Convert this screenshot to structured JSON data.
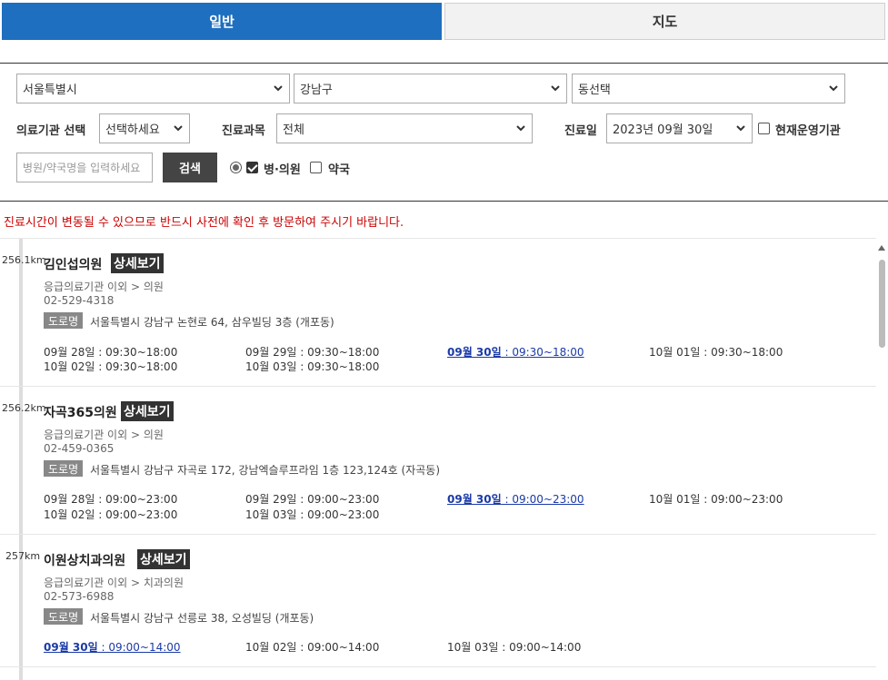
{
  "tabs": {
    "general": "일반",
    "map": "지도"
  },
  "filters": {
    "region1": "서울특별시",
    "region2": "강남구",
    "region3": "동선택",
    "institution_label": "의료기관 선택",
    "institution_value": "선택하세요",
    "dept_label": "진료과목",
    "dept_value": "전체",
    "date_label": "진료일",
    "date_value": "2023년 09월 30일",
    "open_now_label": "현재운영기관",
    "name_placeholder": "병원/약국명을 입력하세요",
    "search_label": "검색",
    "clinic_label": "병·의원",
    "pharmacy_label": "약국"
  },
  "notice": "진료시간이 변동될 수 있으므로 반드시 사전에 확인 후 방문하여 주시기 바랍니다.",
  "detail_label": "상세보기",
  "road_label": "도로명",
  "clinics": [
    {
      "distance": "256.1km",
      "name": "김인섭의원",
      "type": "응급의료기관 이외 > 의원",
      "phone": "02-529-4318",
      "address": "서울특별시 강남구 논현로 64, 삼우빌딩 3층 (개포동)",
      "hours": [
        {
          "day": "09월 28일",
          "time": " : 09:30~18:00",
          "today": false
        },
        {
          "day": "09월 29일",
          "time": " : 09:30~18:00",
          "today": false
        },
        {
          "day": "09월 30일",
          "time": " : 09:30~18:00",
          "today": true
        },
        {
          "day": "10월 01일",
          "time": " : 09:30~18:00",
          "today": false
        },
        {
          "day": "10월 02일",
          "time": " : 09:30~18:00",
          "today": false
        },
        {
          "day": "10월 03일",
          "time": " : 09:30~18:00",
          "today": false
        }
      ]
    },
    {
      "distance": "256.2km",
      "name": "자곡365의원",
      "type": "응급의료기관 이외 > 의원",
      "phone": "02-459-0365",
      "address": "서울특별시 강남구 자곡로 172, 강남엑슬루프라임 1층 123,124호 (자곡동)",
      "hours": [
        {
          "day": "09월 28일",
          "time": " : 09:00~23:00",
          "today": false
        },
        {
          "day": "09월 29일",
          "time": " : 09:00~23:00",
          "today": false
        },
        {
          "day": "09월 30일",
          "time": " : 09:00~23:00",
          "today": true
        },
        {
          "day": "10월 01일",
          "time": " : 09:00~23:00",
          "today": false
        },
        {
          "day": "10월 02일",
          "time": " : 09:00~23:00",
          "today": false
        },
        {
          "day": "10월 03일",
          "time": " : 09:00~23:00",
          "today": false
        }
      ]
    },
    {
      "distance": "257km",
      "name": "이원상치과의원",
      "type": "응급의료기관 이외 > 치과의원",
      "phone": "02-573-6988",
      "address": "서울특별시 강남구 선릉로 38, 오성빌딩 (개포동)",
      "hours": [
        {
          "day": "09월 30일",
          "time": " : 09:00~14:00",
          "today": true
        },
        {
          "day": "10월 02일",
          "time": " : 09:00~14:00",
          "today": false
        },
        {
          "day": "10월 03일",
          "time": " : 09:00~14:00",
          "today": false
        }
      ]
    }
  ]
}
